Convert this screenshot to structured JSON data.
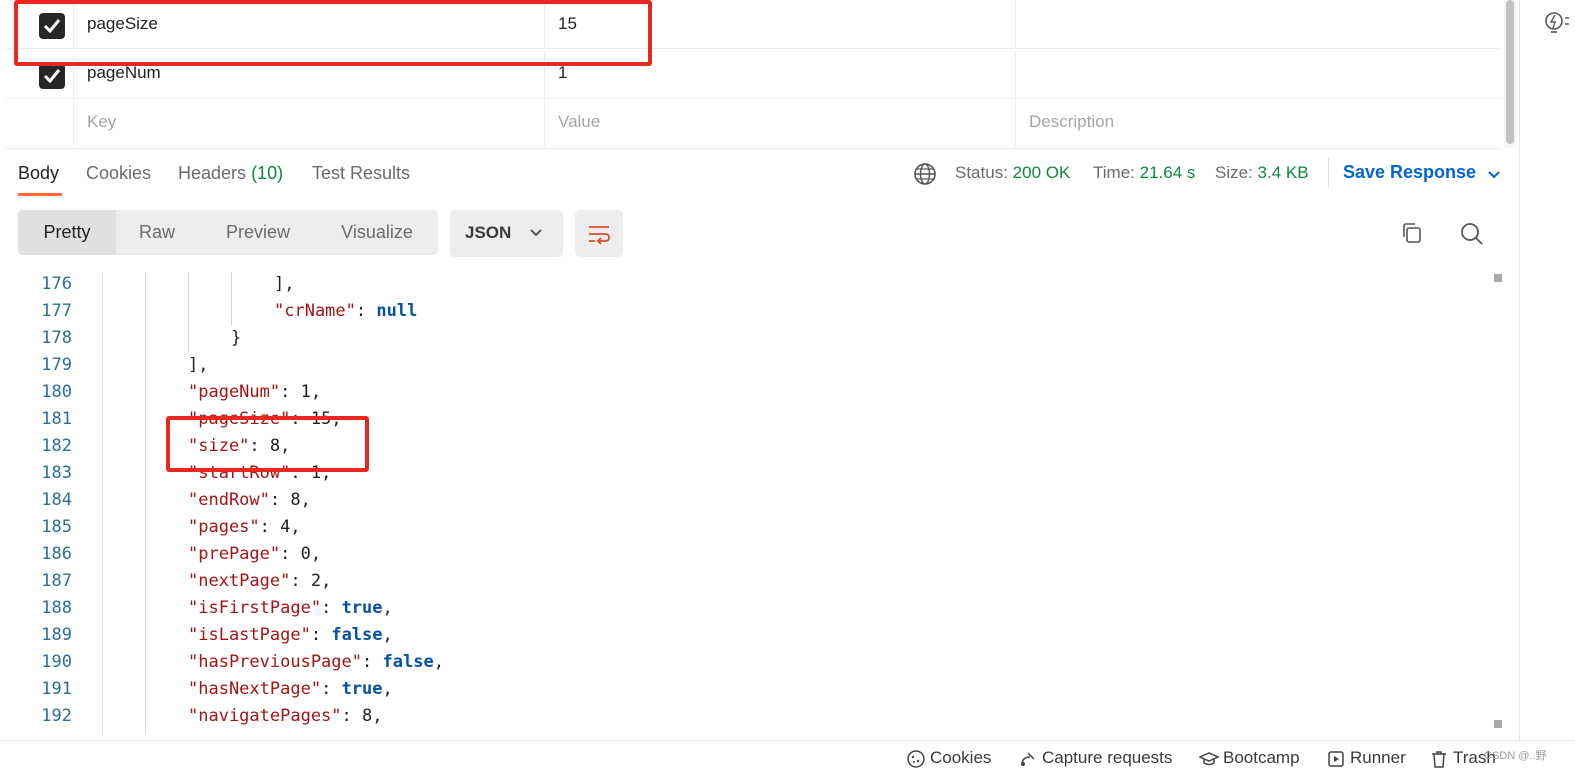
{
  "params": {
    "rows": [
      {
        "checked": true,
        "key": "pageSize",
        "value": "15",
        "description": ""
      },
      {
        "checked": true,
        "key": "pageNum",
        "value": "1",
        "description": ""
      }
    ],
    "placeholder": {
      "key": "Key",
      "value": "Value",
      "description": "Description"
    }
  },
  "response_tabs": {
    "body": "Body",
    "cookies": "Cookies",
    "headers": "Headers",
    "headers_count": "(10)",
    "test_results": "Test Results"
  },
  "response_meta": {
    "status_label": "Status:",
    "status_value": "200 OK",
    "time_label": "Time:",
    "time_value": "21.64 s",
    "size_label": "Size:",
    "size_value": "3.4 KB",
    "save_response": "Save Response"
  },
  "view_modes": [
    "Pretty",
    "Raw",
    "Preview",
    "Visualize"
  ],
  "active_view_mode": "Pretty",
  "format": "JSON",
  "code_lines": [
    {
      "num": "176",
      "text": "],"
    },
    {
      "num": "177",
      "text": "\"crName\": null"
    },
    {
      "num": "178",
      "text": "}"
    },
    {
      "num": "179",
      "text": "],"
    },
    {
      "num": "180",
      "text": "\"pageNum\": 1,"
    },
    {
      "num": "181",
      "text": "\"pageSize\": 15,"
    },
    {
      "num": "182",
      "text": "\"size\": 8,"
    },
    {
      "num": "183",
      "text": "\"startRow\": 1,"
    },
    {
      "num": "184",
      "text": "\"endRow\": 8,"
    },
    {
      "num": "185",
      "text": "\"pages\": 4,"
    },
    {
      "num": "186",
      "text": "\"prePage\": 0,"
    },
    {
      "num": "187",
      "text": "\"nextPage\": 2,"
    },
    {
      "num": "188",
      "text": "\"isFirstPage\": true,"
    },
    {
      "num": "189",
      "text": "\"isLastPage\": false,"
    },
    {
      "num": "190",
      "text": "\"hasPreviousPage\": false,"
    },
    {
      "num": "191",
      "text": "\"hasNextPage\": true,"
    },
    {
      "num": "192",
      "text": "\"navigatePages\": 8,"
    }
  ],
  "footer": {
    "cookies": "Cookies",
    "capture": "Capture requests",
    "bootcamp": "Bootcamp",
    "runner": "Runner",
    "trash": "Trash",
    "watermark": "CSDN @..野"
  },
  "colors": {
    "accent_orange": "#ff6c37",
    "status_green": "#0c8a3e",
    "link_blue": "#0265d2",
    "highlight_red": "#e8281e"
  },
  "icons": [
    "check-icon",
    "globe-icon",
    "chevron-down-icon",
    "wrap-lines-icon",
    "copy-icon",
    "search-icon",
    "cookie-icon",
    "satellite-icon",
    "graduation-cap-icon",
    "play-icon",
    "trash-icon",
    "lightbulb-icon"
  ]
}
